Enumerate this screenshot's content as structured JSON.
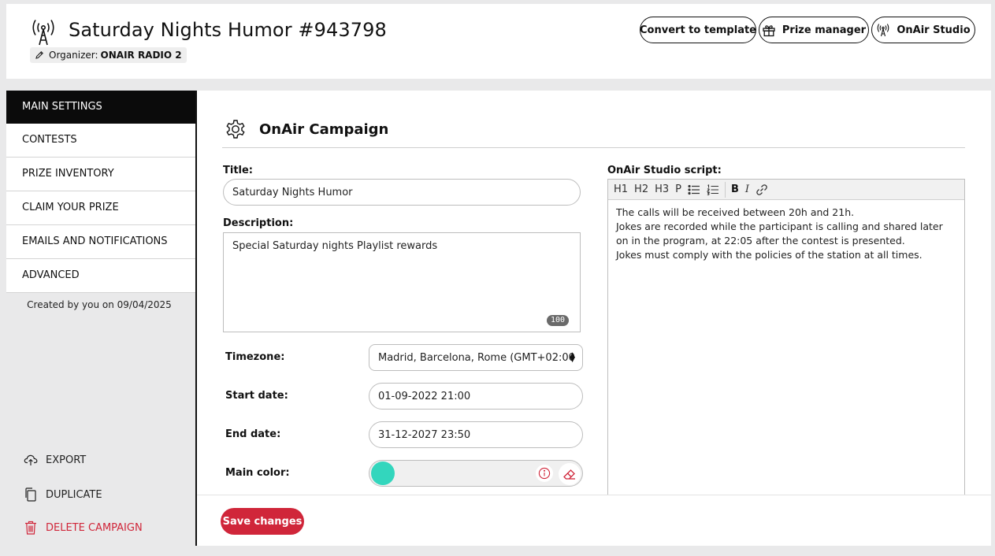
{
  "header": {
    "title": "Saturday Nights Humor #943798",
    "organizer_label": "Organizer:",
    "organizer_name": "ONAIR RADIO 2",
    "buttons": {
      "convert": "Convert to template",
      "prize_manager": "Prize manager",
      "onair_studio": "OnAir Studio"
    }
  },
  "sidebar": {
    "items": [
      {
        "label": "MAIN SETTINGS",
        "active": true
      },
      {
        "label": "CONTESTS"
      },
      {
        "label": "PRIZE INVENTORY"
      },
      {
        "label": "CLAIM YOUR PRIZE"
      },
      {
        "label": "EMAILS AND NOTIFICATIONS"
      },
      {
        "label": "ADVANCED"
      }
    ],
    "created": "Created by you on 09/04/2025",
    "actions": {
      "export": "EXPORT",
      "duplicate": "DUPLICATE",
      "delete": "DELETE CAMPAIGN"
    }
  },
  "main": {
    "section_title": "OnAir Campaign",
    "form": {
      "title_label": "Title:",
      "title_value": "Saturday Nights Humor",
      "description_label": "Description:",
      "description_value": "Special Saturday nights Playlist rewards",
      "description_counter": "100",
      "timezone_label": "Timezone:",
      "timezone_value": "Madrid, Barcelona, Rome (GMT+02:00",
      "start_label": "Start date:",
      "start_value": "01-09-2022 21:00",
      "end_label": "End date:",
      "end_value": "31-12-2027 23:50",
      "color_label": "Main color:",
      "color_value": "#33d6bd"
    },
    "script": {
      "label": "OnAir Studio script:",
      "toolbar": [
        "H1",
        "H2",
        "H3",
        "P",
        "bullet-list-icon",
        "numbered-list-icon",
        "B",
        "I",
        "link-icon"
      ],
      "lines": [
        "The calls will be received between 20h and 21h.",
        "Jokes are recorded while the participant is calling and shared later on in the program, at 22:05 after the contest is presented.",
        "Jokes must comply with the policies of the station at all times."
      ]
    },
    "save_label": "Save changes"
  },
  "colors": {
    "accent_red": "#d0263a",
    "teal": "#33d6bd",
    "active_nav": "#0b0b0b"
  }
}
